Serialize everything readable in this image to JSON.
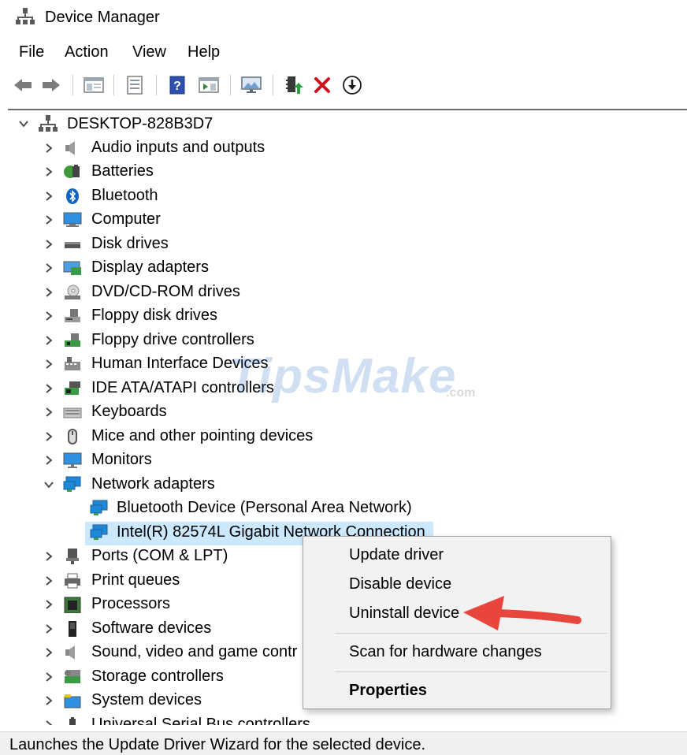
{
  "window": {
    "title": "Device Manager"
  },
  "menu": [
    "File",
    "Action",
    "View",
    "Help"
  ],
  "toolbar": [
    "back-icon",
    "forward-icon",
    "show-hide-console-tree-icon",
    "properties-icon",
    "help-icon",
    "action-pane-icon",
    "monitor-icon",
    "update-driver-icon",
    "uninstall-icon",
    "scan-hardware-icon"
  ],
  "tree": {
    "root": "DESKTOP-828B3D7",
    "categories": [
      {
        "label": "Audio inputs and outputs",
        "icon": "speaker-icon"
      },
      {
        "label": "Batteries",
        "icon": "battery-icon"
      },
      {
        "label": "Bluetooth",
        "icon": "bluetooth-icon"
      },
      {
        "label": "Computer",
        "icon": "computer-icon"
      },
      {
        "label": "Disk drives",
        "icon": "disk-drive-icon"
      },
      {
        "label": "Display adapters",
        "icon": "display-adapter-icon"
      },
      {
        "label": "DVD/CD-ROM drives",
        "icon": "dvd-drive-icon"
      },
      {
        "label": "Floppy disk drives",
        "icon": "floppy-disk-icon"
      },
      {
        "label": "Floppy drive controllers",
        "icon": "floppy-controller-icon"
      },
      {
        "label": "Human Interface Devices",
        "icon": "hid-icon"
      },
      {
        "label": "IDE ATA/ATAPI controllers",
        "icon": "ide-controller-icon"
      },
      {
        "label": "Keyboards",
        "icon": "keyboard-icon"
      },
      {
        "label": "Mice and other pointing devices",
        "icon": "mouse-icon"
      },
      {
        "label": "Monitors",
        "icon": "monitor-icon"
      },
      {
        "label": "Network adapters",
        "icon": "network-adapter-icon",
        "expanded": true,
        "children": [
          {
            "label": "Bluetooth Device (Personal Area Network)"
          },
          {
            "label": "Intel(R) 82574L Gigabit Network Connection",
            "selected": true
          }
        ]
      },
      {
        "label": "Ports (COM & LPT)",
        "icon": "port-icon"
      },
      {
        "label": "Print queues",
        "icon": "printer-icon"
      },
      {
        "label": "Processors",
        "icon": "processor-icon"
      },
      {
        "label": "Software devices",
        "icon": "software-device-icon"
      },
      {
        "label": "Sound, video and game contr",
        "icon": "sound-icon"
      },
      {
        "label": "Storage controllers",
        "icon": "storage-controller-icon"
      },
      {
        "label": "System devices",
        "icon": "system-device-icon"
      },
      {
        "label": "Universal Serial Bus controllers",
        "icon": "usb-icon"
      }
    ]
  },
  "context_menu": {
    "items": [
      "Update driver",
      "Disable device",
      "Uninstall device",
      "Scan for hardware changes",
      "Properties"
    ]
  },
  "watermark": {
    "main": "TipsMake",
    "suffix": ".com"
  },
  "status": "Launches the Update Driver Wizard for the selected device.",
  "colors": {
    "selection": "#cce8ff",
    "arrow": "#e8453c",
    "network_icon": "#1e88d8"
  }
}
